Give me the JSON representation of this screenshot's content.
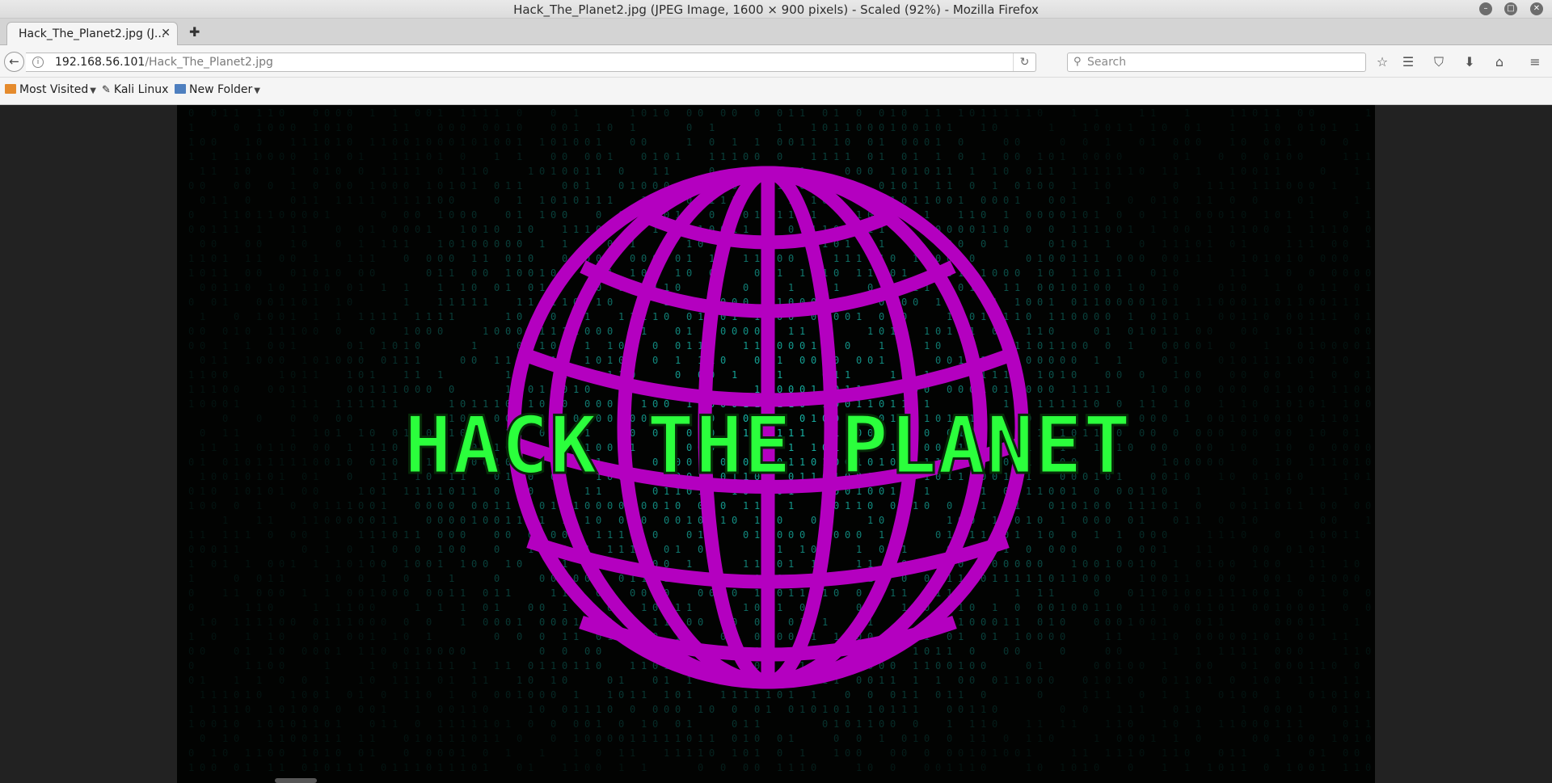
{
  "window": {
    "title": "Hack_The_Planet2.jpg (JPEG Image, 1600 × 900 pixels) - Scaled (92%) - Mozilla Firefox"
  },
  "tabs": [
    {
      "label": "Hack_The_Planet2.jpg (J...",
      "active": true
    }
  ],
  "navbar": {
    "url_host": "192.168.56.101",
    "url_path": "/Hack_The_Planet2.jpg",
    "search_placeholder": "Search"
  },
  "bookmarks": [
    {
      "label": "Most Visited",
      "icon": "folder-icon",
      "has_dropdown": true
    },
    {
      "label": "Kali Linux",
      "icon": "kali-dragon-icon",
      "has_dropdown": false
    },
    {
      "label": "New Folder",
      "icon": "folder-icon",
      "has_dropdown": true
    }
  ],
  "image": {
    "text": "HACK THE PLANET",
    "colors": {
      "background": "#020302",
      "globe": "#b400c0",
      "text": "#2bff3c",
      "binary_rain": "#19c7b8"
    }
  }
}
